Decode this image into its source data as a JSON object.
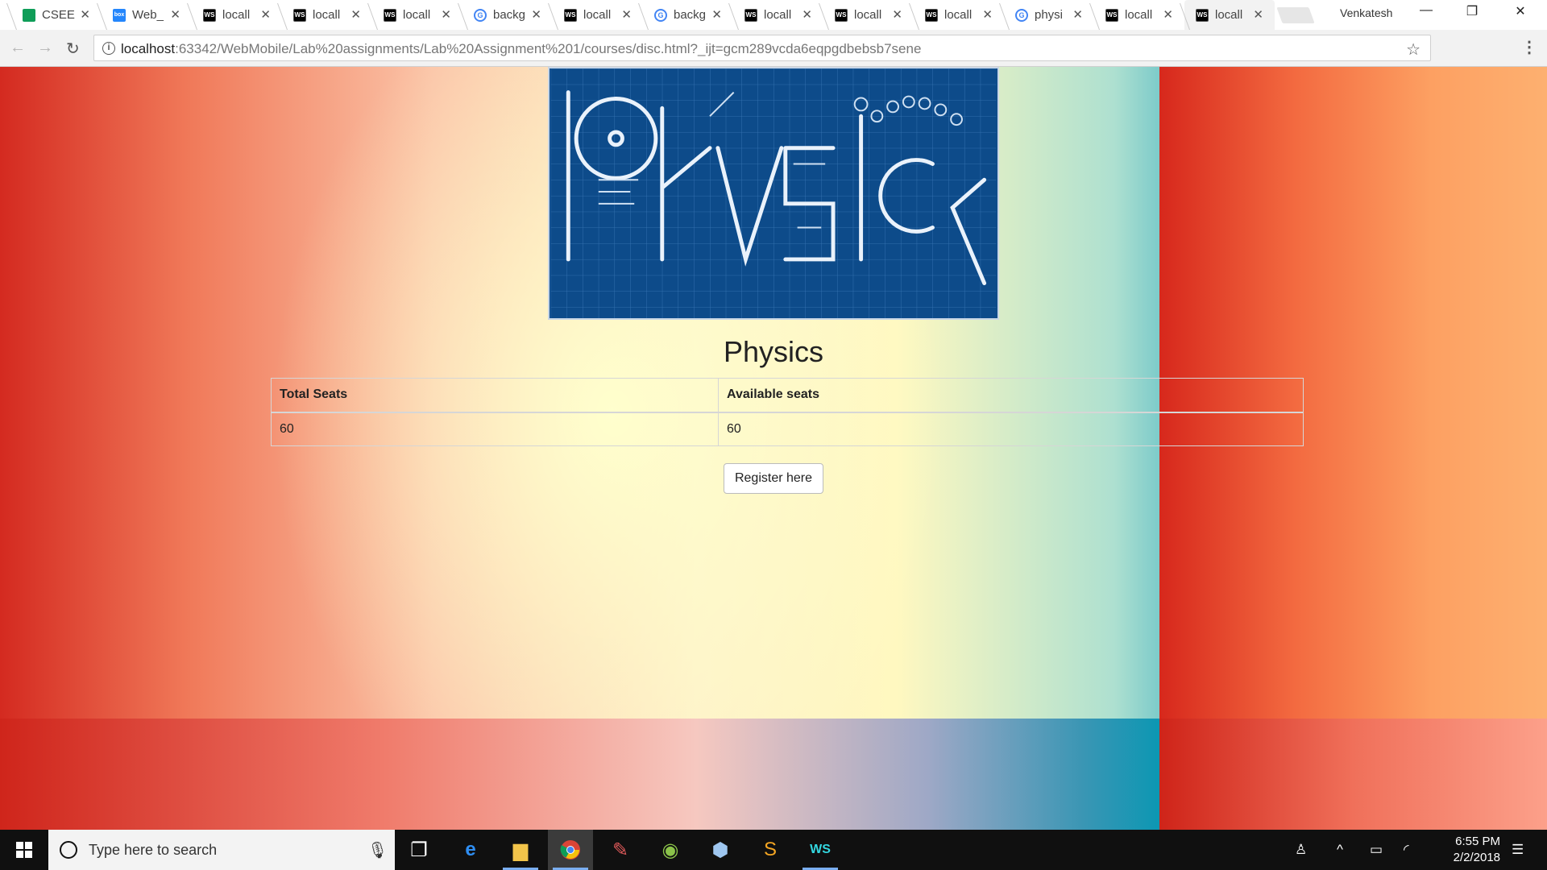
{
  "browser": {
    "tabs": [
      {
        "label": "CSEE",
        "icon": "sheets"
      },
      {
        "label": "Web_",
        "icon": "box"
      },
      {
        "label": "locall",
        "icon": "ws"
      },
      {
        "label": "locall",
        "icon": "ws"
      },
      {
        "label": "locall",
        "icon": "ws"
      },
      {
        "label": "backg",
        "icon": "google"
      },
      {
        "label": "locall",
        "icon": "ws"
      },
      {
        "label": "backg",
        "icon": "google"
      },
      {
        "label": "locall",
        "icon": "ws"
      },
      {
        "label": "locall",
        "icon": "ws"
      },
      {
        "label": "locall",
        "icon": "ws"
      },
      {
        "label": "physi",
        "icon": "google"
      },
      {
        "label": "locall",
        "icon": "ws"
      },
      {
        "label": "locall",
        "icon": "ws"
      }
    ],
    "profile_name": "Venkatesh",
    "url_host": "localhost",
    "url_rest": ":63342/WebMobile/Lab%20assignments/Lab%20Assignment%201/courses/disc.html?_ijt=gcm289vcda6eqpgdbebsb7sene"
  },
  "page": {
    "banner_alt": "PhYsIcS",
    "title": "Physics",
    "table": {
      "headers": [
        "Total Seats",
        "Available seats"
      ],
      "row": [
        "60",
        "60"
      ]
    },
    "register_label": "Register here"
  },
  "taskbar": {
    "search_placeholder": "Type here to search",
    "time": "6:55 PM",
    "date": "2/2/2018"
  },
  "colors": {
    "banner_bg": "#0d4b8a",
    "taskbar_bg": "#101010"
  }
}
